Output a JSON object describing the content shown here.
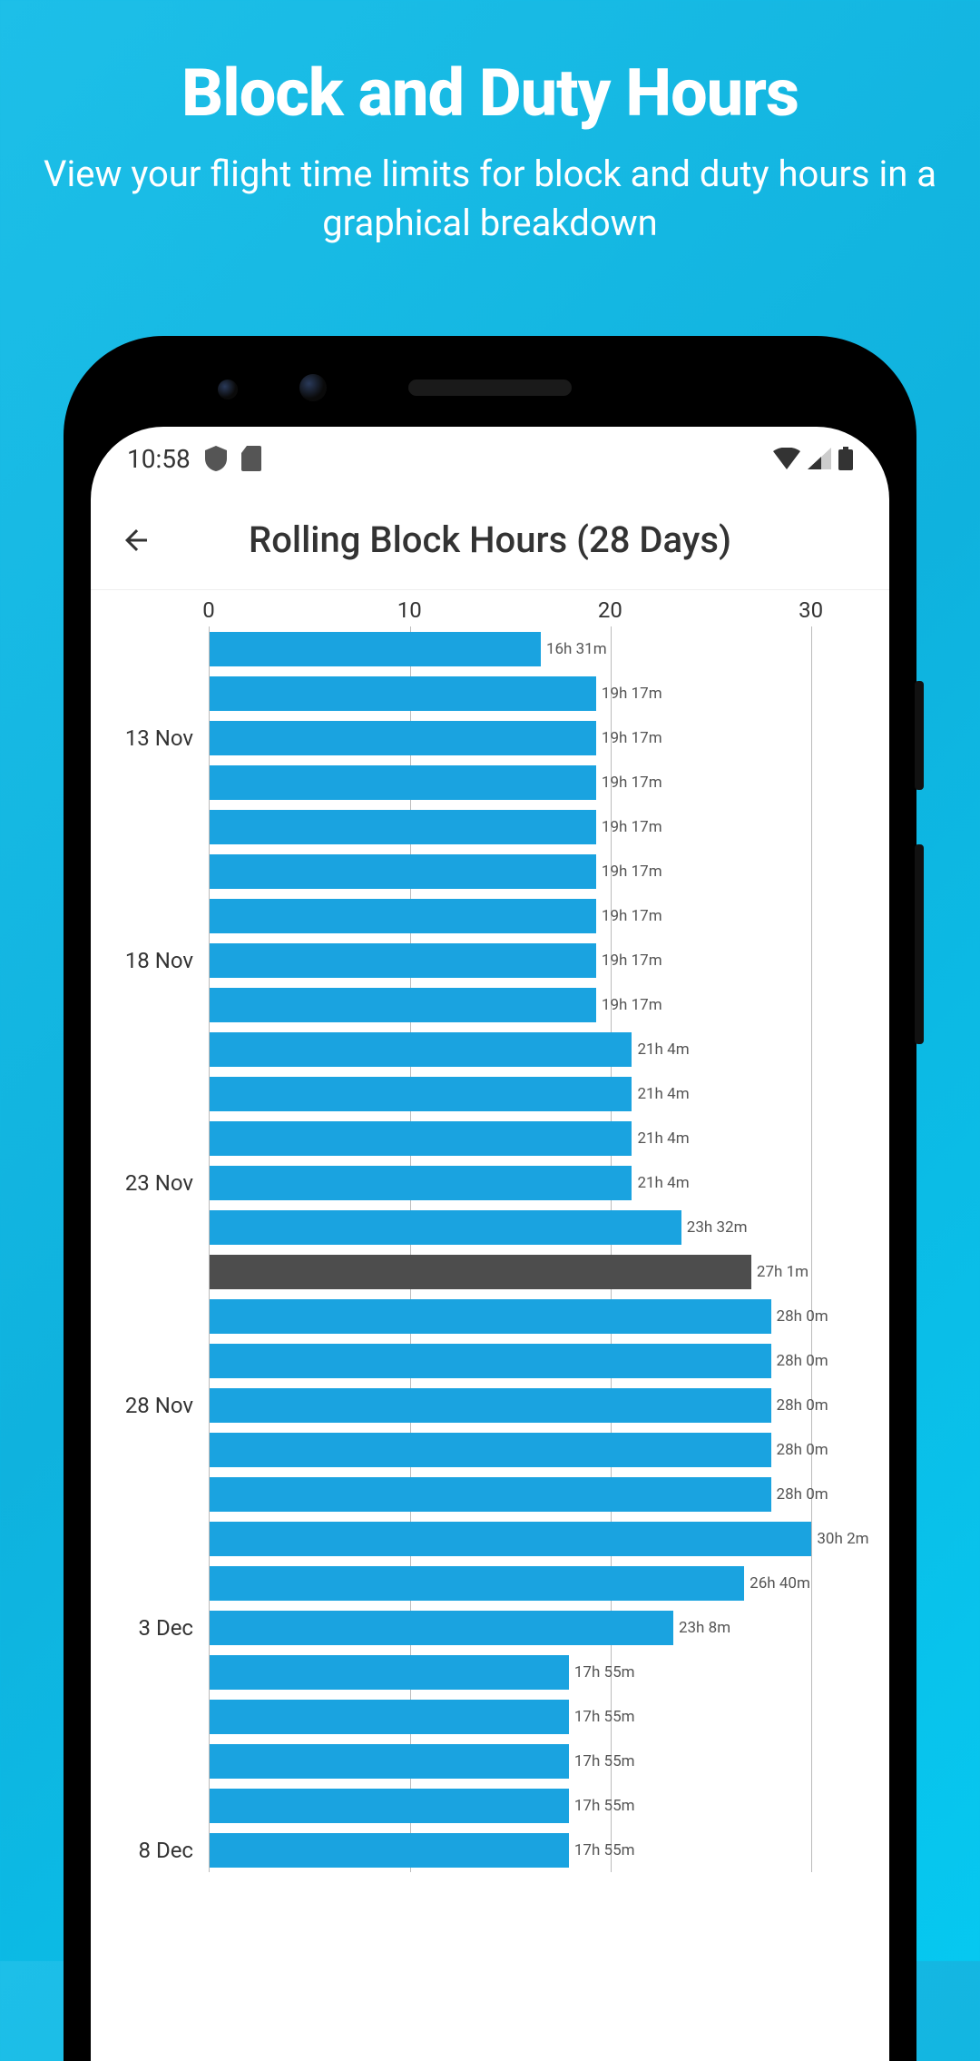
{
  "promo": {
    "title": "Block and Duty Hours",
    "subtitle": "View your flight time limits for block and duty hours in a graphical breakdown"
  },
  "status_bar": {
    "time": "10:58"
  },
  "app_bar": {
    "title": "Rolling Block Hours (28 Days)"
  },
  "chart_data": {
    "type": "bar",
    "orientation": "horizontal",
    "xlabel": "",
    "ylabel": "",
    "xlim": [
      0,
      33
    ],
    "x_ticks": [
      0,
      10,
      20,
      30
    ],
    "y_tick_labels": {
      "2": "13 Nov",
      "7": "18 Nov",
      "12": "23 Nov",
      "17": "28 Nov",
      "22": "3 Dec",
      "27": "8 Dec"
    },
    "highlight_index": 14,
    "series": [
      {
        "label": "16h 31m",
        "value": 16.52
      },
      {
        "label": "19h 17m",
        "value": 19.28
      },
      {
        "label": "19h 17m",
        "value": 19.28
      },
      {
        "label": "19h 17m",
        "value": 19.28
      },
      {
        "label": "19h 17m",
        "value": 19.28
      },
      {
        "label": "19h 17m",
        "value": 19.28
      },
      {
        "label": "19h 17m",
        "value": 19.28
      },
      {
        "label": "19h 17m",
        "value": 19.28
      },
      {
        "label": "19h 17m",
        "value": 19.28
      },
      {
        "label": "21h 4m",
        "value": 21.07
      },
      {
        "label": "21h 4m",
        "value": 21.07
      },
      {
        "label": "21h 4m",
        "value": 21.07
      },
      {
        "label": "21h 4m",
        "value": 21.07
      },
      {
        "label": "23h 32m",
        "value": 23.53
      },
      {
        "label": "27h 1m",
        "value": 27.02
      },
      {
        "label": "28h 0m",
        "value": 28.0
      },
      {
        "label": "28h 0m",
        "value": 28.0
      },
      {
        "label": "28h 0m",
        "value": 28.0
      },
      {
        "label": "28h 0m",
        "value": 28.0
      },
      {
        "label": "28h 0m",
        "value": 28.0
      },
      {
        "label": "30h 2m",
        "value": 30.03
      },
      {
        "label": "26h 40m",
        "value": 26.67
      },
      {
        "label": "23h 8m",
        "value": 23.13
      },
      {
        "label": "17h 55m",
        "value": 17.92
      },
      {
        "label": "17h 55m",
        "value": 17.92
      },
      {
        "label": "17h 55m",
        "value": 17.92
      },
      {
        "label": "17h 55m",
        "value": 17.92
      },
      {
        "label": "17h 55m",
        "value": 17.92
      }
    ]
  }
}
